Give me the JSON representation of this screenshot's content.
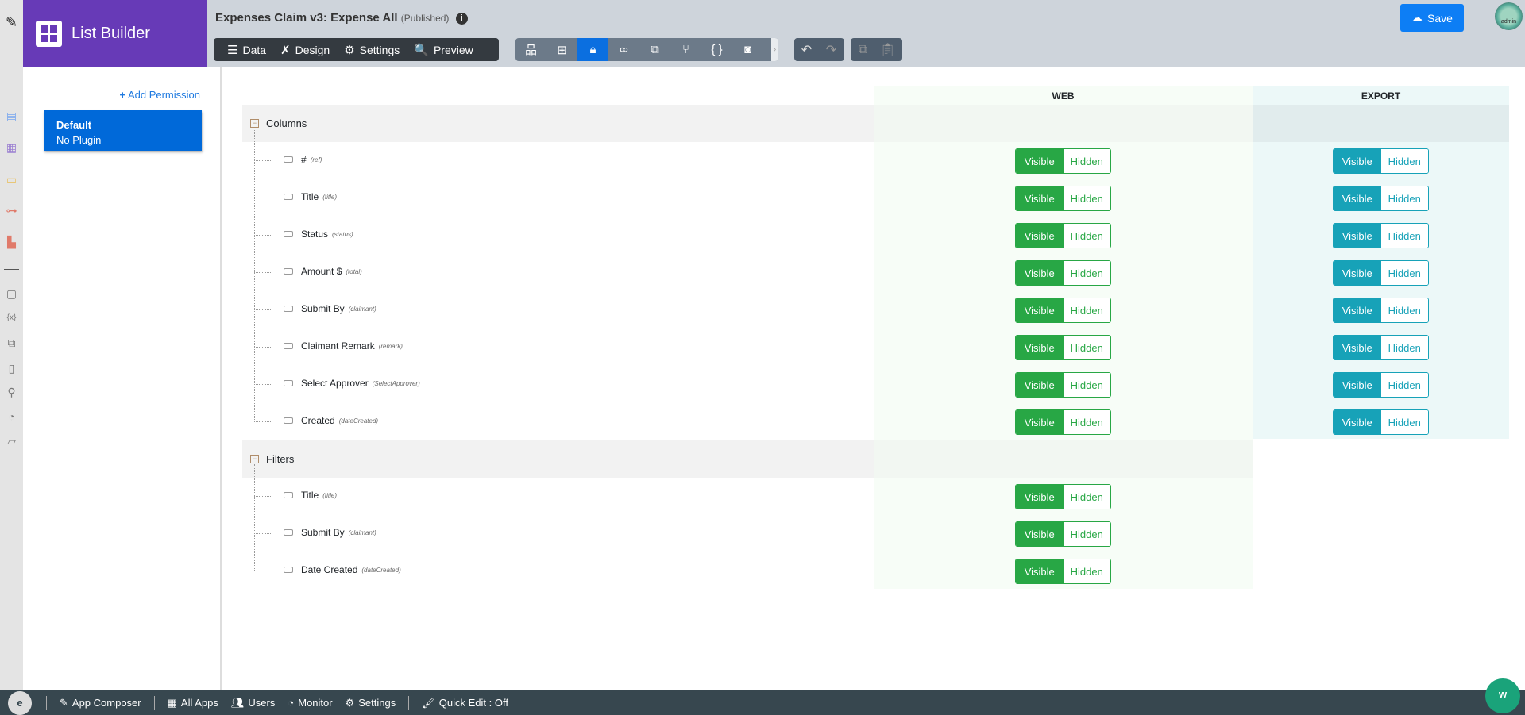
{
  "app": {
    "name": "List Builder",
    "title": "Expenses Claim v3: Expense All",
    "status": "(Published)"
  },
  "toolbar": {
    "data": "Data",
    "design": "Design",
    "settings": "Settings",
    "preview": "Preview",
    "save": "Save",
    "avatar": "admin"
  },
  "permissions": {
    "add": "Add Permission",
    "items": [
      {
        "name": "Default",
        "plugin": "No Plugin"
      }
    ]
  },
  "table": {
    "headers": {
      "web": "WEB",
      "export": "EXPORT"
    },
    "toggle": {
      "visible": "Visible",
      "hidden": "Hidden"
    },
    "groups": [
      {
        "label": "Columns",
        "items": [
          {
            "label": "#",
            "key": "(ref)",
            "web": "Visible",
            "export": "Visible"
          },
          {
            "label": "Title",
            "key": "(title)",
            "web": "Visible",
            "export": "Visible"
          },
          {
            "label": "Status",
            "key": "(status)",
            "web": "Visible",
            "export": "Visible"
          },
          {
            "label": "Amount $",
            "key": "(total)",
            "web": "Visible",
            "export": "Visible"
          },
          {
            "label": "Submit By",
            "key": "(claimant)",
            "web": "Visible",
            "export": "Visible"
          },
          {
            "label": "Claimant Remark",
            "key": "(remark)",
            "web": "Visible",
            "export": "Visible"
          },
          {
            "label": "Select Approver",
            "key": "(SelectApprover)",
            "web": "Visible",
            "export": "Visible"
          },
          {
            "label": "Created",
            "key": "(dateCreated)",
            "web": "Visible",
            "export": "Visible"
          }
        ]
      },
      {
        "label": "Filters",
        "items": [
          {
            "label": "Title",
            "key": "(title)",
            "web": "Visible"
          },
          {
            "label": "Submit By",
            "key": "(claimant)",
            "web": "Visible"
          },
          {
            "label": "Date Created",
            "key": "(dateCreated)",
            "web": "Visible"
          }
        ]
      }
    ]
  },
  "footer": {
    "app_composer": "App Composer",
    "all_apps": "All Apps",
    "users": "Users",
    "monitor": "Monitor",
    "settings": "Settings",
    "quick_edit": "Quick Edit : Off"
  },
  "colors": {
    "brand": "#673ab7",
    "web": "#28a745",
    "export": "#17a2b8",
    "primary": "#0069d9"
  }
}
